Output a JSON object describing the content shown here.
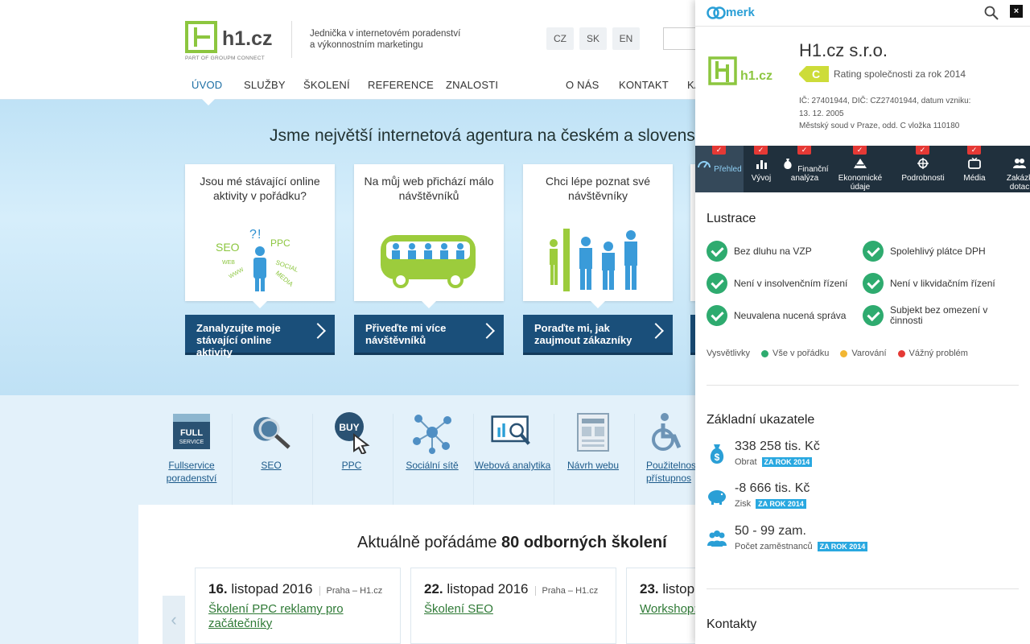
{
  "site": {
    "logo_text": "h1.cz",
    "logo_sub": "PART OF GROUPM CONNECT",
    "tagline_1": "Jednička v internetovém poradenství",
    "tagline_2": "a výkonnostním marketingu",
    "languages": [
      "CZ",
      "SK",
      "EN"
    ],
    "nav": [
      "ÚVOD",
      "SLUŽBY",
      "ŠKOLENÍ",
      "REFERENCE",
      "ZNALOSTI",
      "O NÁS",
      "KONTAKT",
      "KA"
    ],
    "hero_title": "Jsme největší internetová agentura na českém a slovensk",
    "cards": [
      {
        "text": "Jsou mé stávající online aktivity v pořádku?",
        "cta": "Zanalyzujte moje stávající online aktivity"
      },
      {
        "text": "Na můj web přichází málo návštěvníků",
        "cta": "Přiveďte mi více návštěvníků"
      },
      {
        "text": "Chci lépe poznat své návštěvníky",
        "cta": "Poraďte mi, jak zaujmout zákazníky"
      }
    ],
    "card_art_words": [
      "SEO",
      "?",
      "!",
      "PPC",
      "WEB",
      "WWW",
      "SOCIAL",
      "MEDIA"
    ],
    "services": [
      "Fullservice poradenství",
      "SEO",
      "PPC",
      "Sociální sítě",
      "Webová analytika",
      "Návrh webu",
      "Použitelnos přístupnos"
    ],
    "service_icon_text": {
      "full": "FULL",
      "service": "SERVICE",
      "buy": "BUY"
    },
    "trainings_title_prefix": "Aktuálně pořádáme",
    "trainings_title_bold": "80 odborných školení",
    "trainings": [
      {
        "day": "16.",
        "month": "listopad 2016",
        "place": "Praha – H1.cz",
        "title": "Školení PPC reklamy pro začátečníky"
      },
      {
        "day": "22.",
        "month": "listopad 2016",
        "place": "Praha – H1.cz",
        "title": "Školení SEO"
      },
      {
        "day": "23.",
        "month": "listop",
        "place": "",
        "title": "Workshop: Facebooku"
      }
    ],
    "prev_arrow": "‹"
  },
  "merk": {
    "brand": "merk",
    "close": "×",
    "company_logo_text": "h1.cz",
    "company_name": "H1.cz s.r.o.",
    "rating_letter": "C",
    "rating_text": "Rating společnosti za rok 2014",
    "ids_1": "IČ: 27401944, DIČ: CZ27401944, datum vzniku:",
    "ids_2": "13. 12. 2005",
    "ids_3": "Městský soud v Praze, odd. C vložka 110180",
    "tabs": [
      {
        "label": "Přehled",
        "icon": "gauge-icon"
      },
      {
        "label": "Vývoj",
        "icon": "bar-chart-icon"
      },
      {
        "label": "Finanční analýza",
        "icon": "money-bag-icon"
      },
      {
        "label": "Ekonomické údaje",
        "icon": "pyramid-icon"
      },
      {
        "label": "Podrobnosti",
        "icon": "crosshair-icon"
      },
      {
        "label": "Média",
        "icon": "tv-icon"
      },
      {
        "label": "Zakázk dotac",
        "icon": "people-icon"
      }
    ],
    "check_mark": "✓",
    "lustrace_title": "Lustrace",
    "lustrace": [
      "Bez dluhu na VZP",
      "Spolehlivý plátce DPH",
      "Není v insolvenčním řízení",
      "Není v likvidačním řízení",
      "Neuvalena nucená správa",
      "Subjekt bez omezení v činnosti"
    ],
    "legend": {
      "label": "Vysvětlivky",
      "ok": "Vše v pořádku",
      "warn": "Varování",
      "bad": "Vážný problém",
      "ok_color": "#2eab6f",
      "warn_color": "#f2b632",
      "bad_color": "#e53935"
    },
    "indicators_title": "Základní ukazatele",
    "indicators": [
      {
        "value": "338 258 tis. Kč",
        "label": "Obrat",
        "tag": "ZA ROK 2014"
      },
      {
        "value": "-8 666 tis. Kč",
        "label": "Zisk",
        "tag": "ZA ROK 2014"
      },
      {
        "value": "50 - 99 zam.",
        "label": "Počet zaměstnanců",
        "tag": "ZA ROK 2014"
      }
    ],
    "contacts_title": "Kontakty"
  }
}
